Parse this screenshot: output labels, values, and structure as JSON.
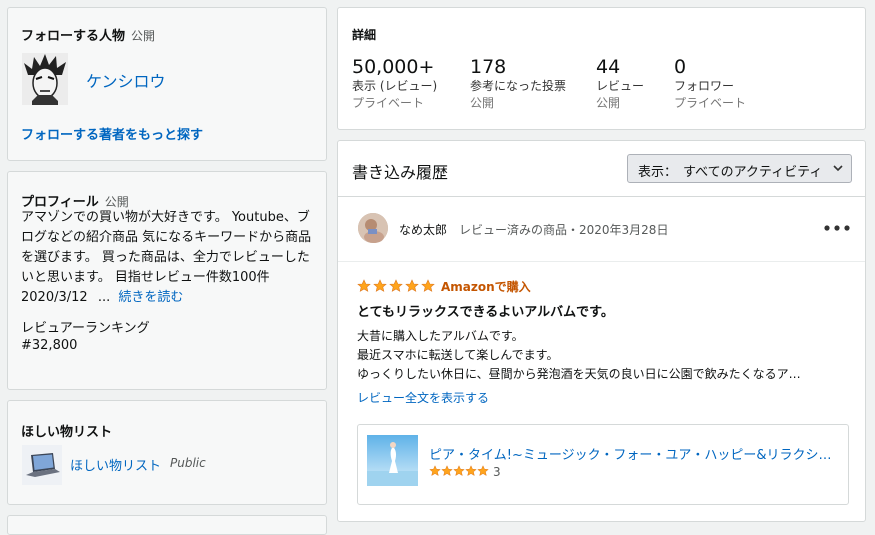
{
  "follow": {
    "header": "フォローする人物",
    "visibility": "公開",
    "person_name": "ケンシロウ",
    "find_more": "フォローする著者をもっと探す"
  },
  "profile": {
    "header": "プロフィール",
    "visibility": "公開",
    "bio_lines": [
      "アマゾンでの買い物が大好きです。 Youtube、ブ",
      "ログなどの紹介商品 気になるキーワードから商品",
      "を選びます。 買った商品は、全力でレビューした",
      "いと思います。 目指せレビュー件数100件"
    ],
    "bio_date": "2020/3/12",
    "ellipsis": "...",
    "read_more": "続きを読む",
    "ranking_label": "レビュアーランキング",
    "ranking_value": "#32,800"
  },
  "wishlist": {
    "header": "ほしい物リスト",
    "list_name": "ほしい物リスト",
    "visibility": "Public"
  },
  "details": {
    "header": "詳細",
    "stats": [
      {
        "value": "50,000+",
        "label": "表示 (レビュー)",
        "visibility": "プライベート"
      },
      {
        "value": "178",
        "label": "参考になった投票",
        "visibility": "公開"
      },
      {
        "value": "44",
        "label": "レビュー",
        "visibility": "公開"
      },
      {
        "value": "0",
        "label": "フォロワー",
        "visibility": "プライベート"
      }
    ]
  },
  "activity": {
    "title": "書き込み履歴",
    "filter_label": "表示：",
    "filter_value": "すべてのアクティビティ",
    "review": {
      "user_name": "なめ太郎",
      "meta": "レビュー済みの商品・2020年3月28日",
      "rating": 5,
      "badge": "Amazonで購入",
      "title": "とてもリラックスできるよいアルバムです。",
      "body_lines": [
        "大昔に購入したアルバムです。",
        "最近スマホに転送して楽しんでます。",
        "ゆっくりしたい休日に、昼間から発泡酒を天気の良い日に公園で飲みたくなるア…"
      ],
      "show_full": "レビュー全文を表示する",
      "product": {
        "name": "ピア・タイム!~ミュージック・フォー・ユア・ハッピー&リラクシ…",
        "rating": 5,
        "rating_count": "3"
      }
    }
  },
  "colors": {
    "link": "#0066c0",
    "star": "#ffa41c",
    "badge": "#c45500"
  }
}
